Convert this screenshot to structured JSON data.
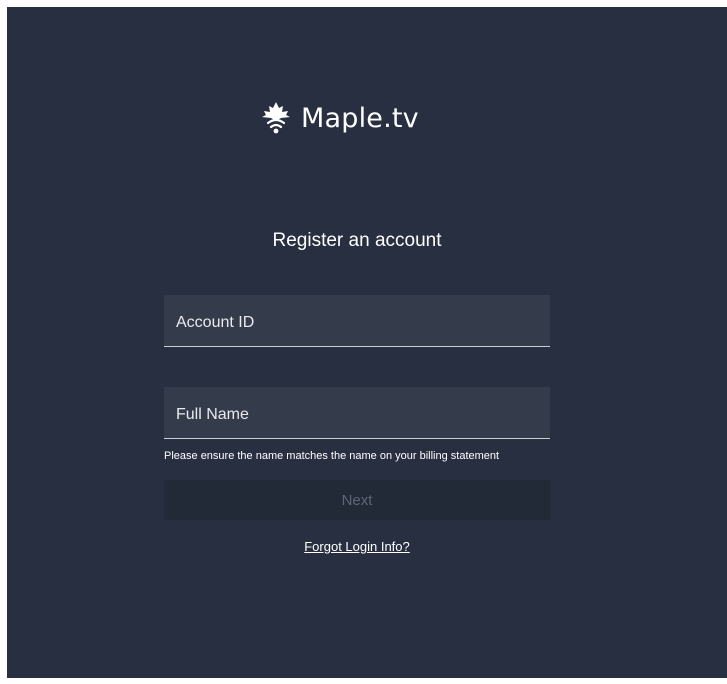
{
  "app": {
    "brand_name": "Maple.tv",
    "logo_icon": "maple-leaf-wifi-icon"
  },
  "form": {
    "title": "Register an account",
    "account_id": {
      "placeholder": "Account ID",
      "value": ""
    },
    "full_name": {
      "placeholder": "Full Name",
      "value": ""
    },
    "helper_text": "Please ensure the name matches the name on your billing statement",
    "next_label": "Next",
    "forgot_label": "Forgot Login Info?"
  },
  "colors": {
    "background": "#272f40",
    "field_background": "#343b4a",
    "button_background": "#222a38",
    "disabled_text": "#5d6676",
    "text": "#ffffff"
  }
}
